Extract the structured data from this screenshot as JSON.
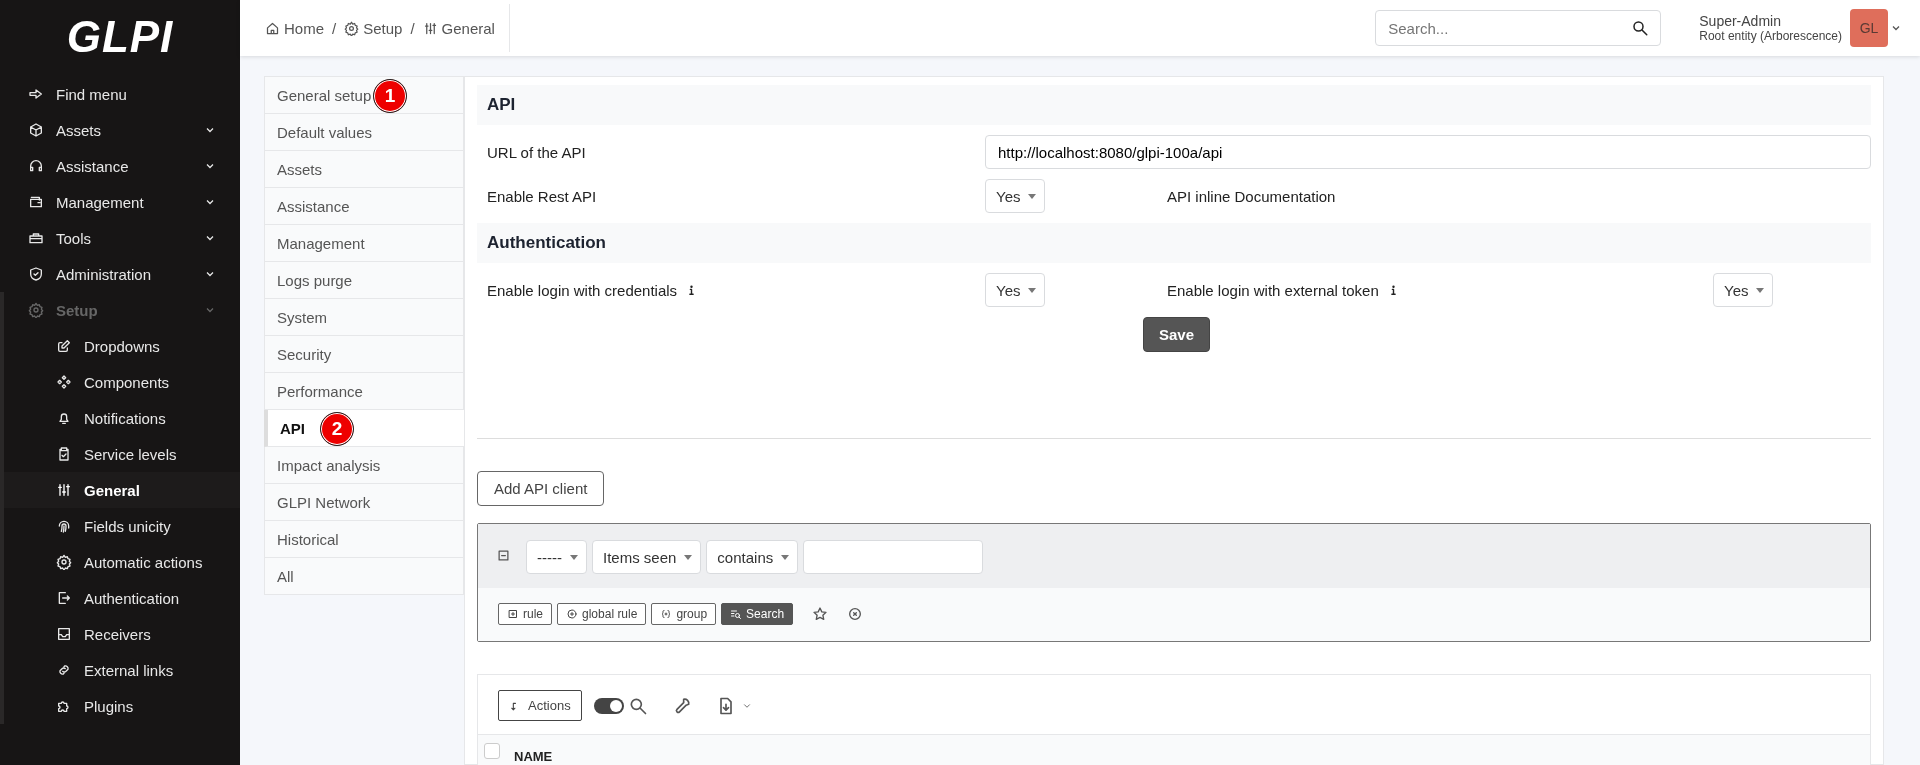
{
  "logo": {
    "text": "GLPI"
  },
  "sidebar": {
    "items": [
      {
        "label": "Find menu",
        "kind": "link",
        "expanded": false
      },
      {
        "label": "Assets",
        "kind": "menu",
        "expanded": false
      },
      {
        "label": "Assistance",
        "kind": "menu",
        "expanded": false
      },
      {
        "label": "Management",
        "kind": "menu",
        "expanded": false
      },
      {
        "label": "Tools",
        "kind": "menu",
        "expanded": false
      },
      {
        "label": "Administration",
        "kind": "menu",
        "expanded": false
      },
      {
        "label": "Setup",
        "kind": "menu",
        "expanded": true,
        "children": [
          {
            "label": "Dropdowns",
            "selected": false
          },
          {
            "label": "Components",
            "selected": false
          },
          {
            "label": "Notifications",
            "selected": false
          },
          {
            "label": "Service levels",
            "selected": false
          },
          {
            "label": "General",
            "selected": true
          },
          {
            "label": "Fields unicity",
            "selected": false
          },
          {
            "label": "Automatic actions",
            "selected": false
          },
          {
            "label": "Authentication",
            "selected": false
          },
          {
            "label": "Receivers",
            "selected": false
          },
          {
            "label": "External links",
            "selected": false
          },
          {
            "label": "Plugins",
            "selected": false
          }
        ]
      }
    ]
  },
  "breadcrumb": [
    {
      "label": "Home"
    },
    {
      "separator": "/",
      "label": "Setup"
    },
    {
      "separator": "/",
      "label": "General"
    }
  ],
  "search": {
    "placeholder": "Search..."
  },
  "user": {
    "name": "Super-Admin",
    "entity": "Root entity (Arborescence)",
    "avatar": "GL"
  },
  "tabs": [
    {
      "label": "General setup",
      "selected": false,
      "badge": "1"
    },
    {
      "label": "Default values",
      "selected": false
    },
    {
      "label": "Assets",
      "selected": false
    },
    {
      "label": "Assistance",
      "selected": false
    },
    {
      "label": "Management",
      "selected": false
    },
    {
      "label": "Logs purge",
      "selected": false
    },
    {
      "label": "System",
      "selected": false
    },
    {
      "label": "Security",
      "selected": false
    },
    {
      "label": "Performance",
      "selected": false
    },
    {
      "label": "API",
      "selected": true,
      "badge": "2"
    },
    {
      "label": "Impact analysis",
      "selected": false
    },
    {
      "label": "GLPI Network",
      "selected": false
    },
    {
      "label": "Historical",
      "selected": false
    },
    {
      "label": "All",
      "selected": false
    }
  ],
  "api_section": {
    "title": "API",
    "url_label": "URL of the API",
    "url_value": "http://localhost:8080/glpi-100a/api",
    "rest_label": "Enable Rest API",
    "rest_value": "Yes",
    "doc_link": "API inline Documentation"
  },
  "auth_section": {
    "title": "Authentication",
    "credentials_label": "Enable login with credentials",
    "credentials_value": "Yes",
    "token_label": "Enable login with external token",
    "token_value": "Yes"
  },
  "save_button": "Save",
  "add_client_button": "Add API client",
  "search_criteria": {
    "link": "-----",
    "field": "Items seen",
    "operator": "contains",
    "buttons": [
      "rule",
      "global rule",
      "group"
    ],
    "search_button": "Search"
  },
  "results": {
    "actions_button": "Actions",
    "toggle_on": true,
    "all_checked": false,
    "columns": [
      "NAME"
    ]
  }
}
